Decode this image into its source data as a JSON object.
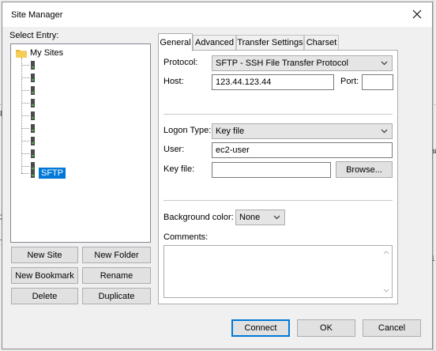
{
  "dialog": {
    "title": "Site Manager"
  },
  "tree": {
    "select_entry_label": "Select Entry:",
    "root_label": "My Sites",
    "selected_label": "SFTP",
    "unnamed_count": 9
  },
  "buttons": {
    "new_site": "New Site",
    "new_folder": "New Folder",
    "new_bookmark": "New Bookmark",
    "rename": "Rename",
    "delete": "Delete",
    "duplicate": "Duplicate",
    "connect": "Connect",
    "ok": "OK",
    "cancel": "Cancel",
    "browse": "Browse..."
  },
  "tabs": [
    "General",
    "Advanced",
    "Transfer Settings",
    "Charset"
  ],
  "general": {
    "protocol_label": "Protocol:",
    "protocol_value": "SFTP - SSH File Transfer Protocol",
    "host_label": "Host:",
    "host_value": "123.44.123.44",
    "port_label": "Port:",
    "port_value": "",
    "logon_type_label": "Logon Type:",
    "logon_type_value": "Key file",
    "user_label": "User:",
    "user_value": "ec2-user",
    "key_file_label": "Key file:",
    "key_file_value": "",
    "bg_color_label": "Background color:",
    "bg_color_value": "None",
    "comments_label": "Comments:"
  },
  "background_fragments": [
    "Fi",
    "35",
    "74",
    "7",
    "ar",
    "1"
  ],
  "colors": {
    "selection": "#0078d7",
    "folder": "#e8b93c",
    "default_button_border": "#0078d7"
  }
}
